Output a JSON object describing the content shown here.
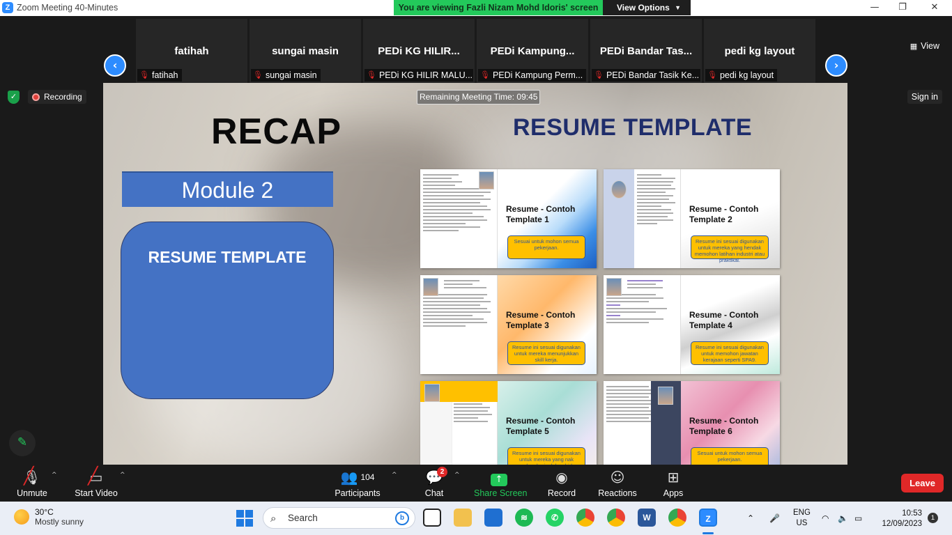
{
  "window": {
    "app_logo": "Z",
    "title": "Zoom Meeting 40-Minutes",
    "viewing_banner": "You are viewing Fazli Nizam Mohd Idoris' screen",
    "view_options_label": "View Options",
    "controls": {
      "minimize": "—",
      "restore": "❐",
      "close": "✕"
    }
  },
  "participants": [
    {
      "name": "fatihah",
      "label": "fatihah"
    },
    {
      "name": "sungai masin",
      "label": "sungai masin"
    },
    {
      "name": "PEDi KG HILIR...",
      "label": "PEDi KG HILIR MALU..."
    },
    {
      "name": "PEDi  Kampung...",
      "label": "PEDi Kampung Perm..."
    },
    {
      "name": "PEDi Bandar Tas...",
      "label": "PEDi Bandar Tasik Ke..."
    },
    {
      "name": "pedi kg layout",
      "label": "pedi kg layout"
    }
  ],
  "view_button": "View",
  "recording_label": "Recording",
  "signin_label": "Sign in",
  "slide": {
    "remaining_time": "Remaining Meeting Time: 09:45",
    "recap": "RECAP",
    "module": "Module 2",
    "box_title": "RESUME TEMPLATE",
    "main_title": "RESUME TEMPLATE",
    "cards": [
      {
        "title": "Resume - Contoh Template 1",
        "note": "Sesuai untuk mohon semua pekerjaan."
      },
      {
        "title": "Resume - Contoh Template 2",
        "note": "Resume ini sesuai digunakan untuk mereka yang hendak memohon latihan industri atau praktikal."
      },
      {
        "title": "Resume - Contoh Template 3",
        "note": "Resume ini sesuai digunakan untuk mereka menunjukkan skill kerja."
      },
      {
        "title": "Resume - Contoh Template 4",
        "note": "Resume ini sesuai digunakan untuk memohon jawatan kerajaan seperti SPA9."
      },
      {
        "title": "Resume - Contoh Template 5",
        "note": "Resume ini sesuai digunakan untuk mereka yang nak memohon kerja dalam bidang creative"
      },
      {
        "title": "Resume - Contoh Template 6",
        "note": "Sesuai untuk mohon semua pekerjaan."
      }
    ]
  },
  "toolbar": {
    "unmute": "Unmute",
    "start_video": "Start Video",
    "participants_label": "Participants",
    "participants_count": "104",
    "chat": "Chat",
    "chat_badge": "2",
    "share_screen": "Share Screen",
    "record": "Record",
    "reactions": "Reactions",
    "apps": "Apps",
    "leave": "Leave"
  },
  "taskbar": {
    "temperature": "30°C",
    "weather": "Mostly sunny",
    "search_placeholder": "Search",
    "language": "ENG",
    "region": "US",
    "time": "10:53",
    "date": "12/09/2023",
    "notifications": "1"
  },
  "colors": {
    "zoom_blue": "#2d8cff",
    "share_green": "#23c95b",
    "leave_red": "#e02828",
    "slide_blue": "#4472c4",
    "slide_title": "#1f2d6b",
    "note_yellow": "#ffc000"
  }
}
